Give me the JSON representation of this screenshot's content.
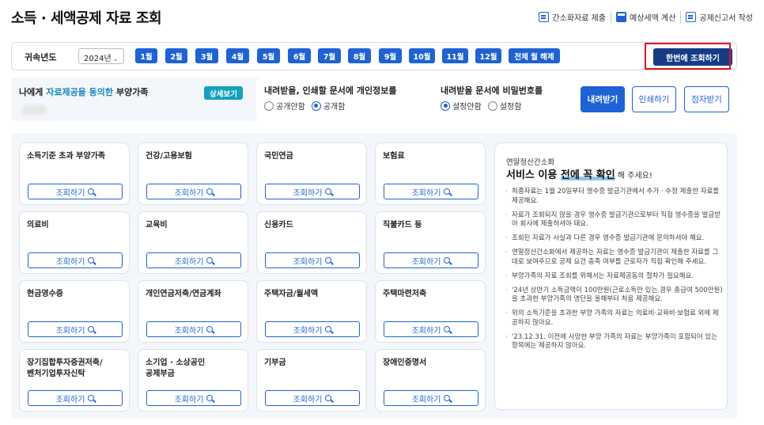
{
  "page": {
    "title": "소득 · 세액공제 자료 조회"
  },
  "top_links": [
    {
      "label": "간소화자료 제출",
      "icon": "document-icon"
    },
    {
      "label": "예상세액 계산",
      "icon": "calculator-icon"
    },
    {
      "label": "공제신고서 작성",
      "icon": "document-edit-icon"
    }
  ],
  "year_bar": {
    "label": "귀속년도",
    "selected_year": "2024년",
    "months": [
      "1월",
      "2월",
      "3월",
      "4월",
      "5월",
      "6월",
      "7월",
      "8월",
      "9월",
      "10월",
      "11월",
      "12월"
    ],
    "clear_label": "전체 월 해제",
    "query_all_label": "한번에 조회하기"
  },
  "dependents": {
    "title_prefix": "나에게 ",
    "title_highlight": "자료제공을 동의한",
    "title_suffix": " 부양가족",
    "detail_button": "상세보기"
  },
  "privacy": {
    "personal_info_title": "내려받을, 인쇄할 문서에 개인정보를",
    "personal_info_options": [
      "공개안함",
      "공개함"
    ],
    "personal_info_selected": "공개함",
    "password_title": "내려받을 문서에 비밀번호를",
    "password_options": [
      "설정안함",
      "설정함"
    ],
    "password_selected": "설정안함",
    "download_label": "내려받기",
    "print_label": "인쇄하기",
    "braille_label": "점자받기"
  },
  "query_button_label": "조회하기",
  "categories": [
    "소득기준 초과 부양가족",
    "건강/고용보험",
    "국민연금",
    "보험료",
    "의료비",
    "교육비",
    "신용카드",
    "직불카드 등",
    "현금영수증",
    "개인연금저축/연금계좌",
    "주택자금/월세액",
    "주택마련저축",
    "장기집합투자증권저축/\n벤처기업투자신탁",
    "소기업 · 소상공인\n공제부금",
    "기부금",
    "장애인증명서"
  ],
  "notice": {
    "label": "연말정산간소화",
    "heading_prefix": "서비스 이용 ",
    "heading_emphasis": "전에 꼭 확인",
    "heading_suffix": " 해 주세요!",
    "items": [
      "최종자료는 1월 20일부터 영수증 발급기관에서 추가 · 수정 제출한 자료를 제공해요.",
      "자료가 조회되지 않을 경우 영수증 발급기관으로부터 직접 영수증을 발급받아 회사에 제출하셔야 돼요.",
      "조회된 자료가 사실과 다른 경우 영수증 발급기관에 문의하셔야 해요.",
      "연말정산간소화에서 제공하는 자료는 영수증 발급기관이 제출한 자료를 그대로 보여주므로 공제 요건 충족 여부를 근로자가 직접 확인해 주세요.",
      "부양가족의 자료 조회를 위해서는 자료제공동의 절차가 필요해요.",
      "'24년 상반기 소득금액이 100만원(근로소득만 있는 경우 총급여 500만원)을 초과한 부양가족의 명단을 올해부터 처음 제공해요.",
      "위의 소득기준을 초과한 부양 가족의 자료는 의료비·교육비·보험료 외에 제공하지 않아요.",
      "'23.12.31. 이전에 사망한 부양 가족의 자료는 부양가족이 포함되어 있는 항목에는 제공하지 않아요."
    ]
  },
  "colors": {
    "primary": "#1e63d6",
    "dark": "#163c86",
    "teal": "#13a1bb",
    "highlight": "#e0141e"
  }
}
